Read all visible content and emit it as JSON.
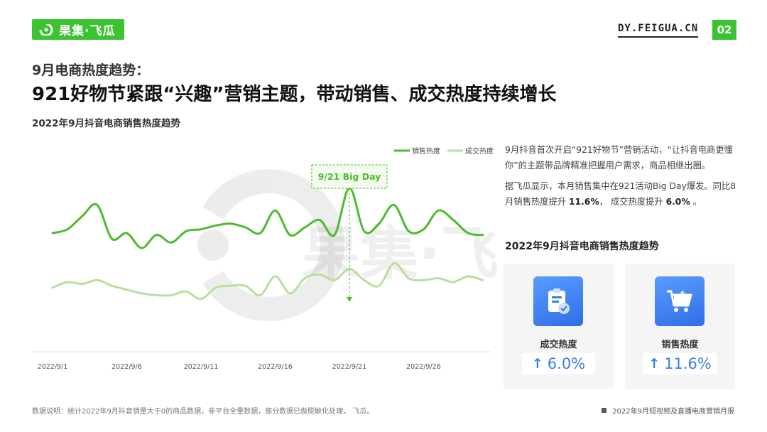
{
  "header": {
    "logo_text": "果集·飞瓜",
    "site": "DY.FEIGUA.CN",
    "page_number": "02",
    "brand_color": "#3cc331"
  },
  "kicker": "9月电商热度趋势：",
  "headline": "921好物节紧跟“兴趣”营销主题，带动销售、成交热度持续增长",
  "chart_data": {
    "type": "line",
    "title": "2022年9月抖音电商销售热度趋势",
    "x": [
      "2022/9/1",
      "2022/9/2",
      "2022/9/3",
      "2022/9/4",
      "2022/9/5",
      "2022/9/6",
      "2022/9/7",
      "2022/9/8",
      "2022/9/9",
      "2022/9/10",
      "2022/9/11",
      "2022/9/12",
      "2022/9/13",
      "2022/9/14",
      "2022/9/15",
      "2022/9/16",
      "2022/9/17",
      "2022/9/18",
      "2022/9/19",
      "2022/9/20",
      "2022/9/21",
      "2022/9/22",
      "2022/9/23",
      "2022/9/24",
      "2022/9/25",
      "2022/9/26",
      "2022/9/27",
      "2022/9/28",
      "2022/9/29",
      "2022/9/30"
    ],
    "tick_labels": [
      "2022/9/1",
      "2022/9/6",
      "2022/9/11",
      "2022/9/16",
      "2022/9/21",
      "2022/9/26"
    ],
    "tick_indices": [
      0,
      5,
      10,
      15,
      20,
      25
    ],
    "ylim": [
      0,
      100
    ],
    "grid": false,
    "legend_position": "top-right",
    "series": [
      {
        "name": "销售热度",
        "color": "#4cbb2f",
        "values": [
          63,
          65,
          72,
          78,
          60,
          63,
          55,
          62,
          58,
          64,
          65,
          67,
          68,
          66,
          63,
          75,
          62,
          66,
          70,
          62,
          87,
          64,
          68,
          78,
          64,
          65,
          75,
          70,
          63,
          62
        ]
      },
      {
        "name": "成交热度",
        "color": "#b7e09f",
        "values": [
          34,
          37,
          36,
          38,
          35,
          33,
          31,
          30,
          30,
          32,
          28,
          34,
          35,
          35,
          30,
          40,
          31,
          39,
          41,
          38,
          44,
          38,
          35,
          47,
          39,
          38,
          39,
          37,
          40,
          38
        ]
      }
    ],
    "annotation": {
      "text": "9/21 Big Day",
      "index": 20
    }
  },
  "paragraphs": {
    "p1": "9月抖音首次开启“921好物节”营销活动，“让抖音电商更懂你”的主题带品牌精准把握用户需求，商品相继出圈。",
    "p2_prefix": "据飞瓜显示，本月销售集中在921活动Big Day爆发。同比8月销售热度提升 ",
    "p2_v1": "11.6%",
    "p2_mid": "， 成交热度提升 ",
    "p2_v2": "6.0%",
    "p2_suffix": " 。"
  },
  "sub_title": "2022年9月抖音电商销售热度趋势",
  "cards": [
    {
      "label": "成交热度",
      "arrow": "↑",
      "value": "6.0%",
      "icon": "clipboard-check-icon"
    },
    {
      "label": "销售热度",
      "arrow": "↑",
      "value": "11.6%",
      "icon": "shopping-cart-icon"
    }
  ],
  "accent_blue": "#3b7dec",
  "footnote": "数据说明：统计2022年9月抖音销量大于0的商品数据，非平台全量数据，部分数据已做脱敏化处理， 飞瓜。",
  "report_name": "2022年9月短视频及直播电商营销月报"
}
